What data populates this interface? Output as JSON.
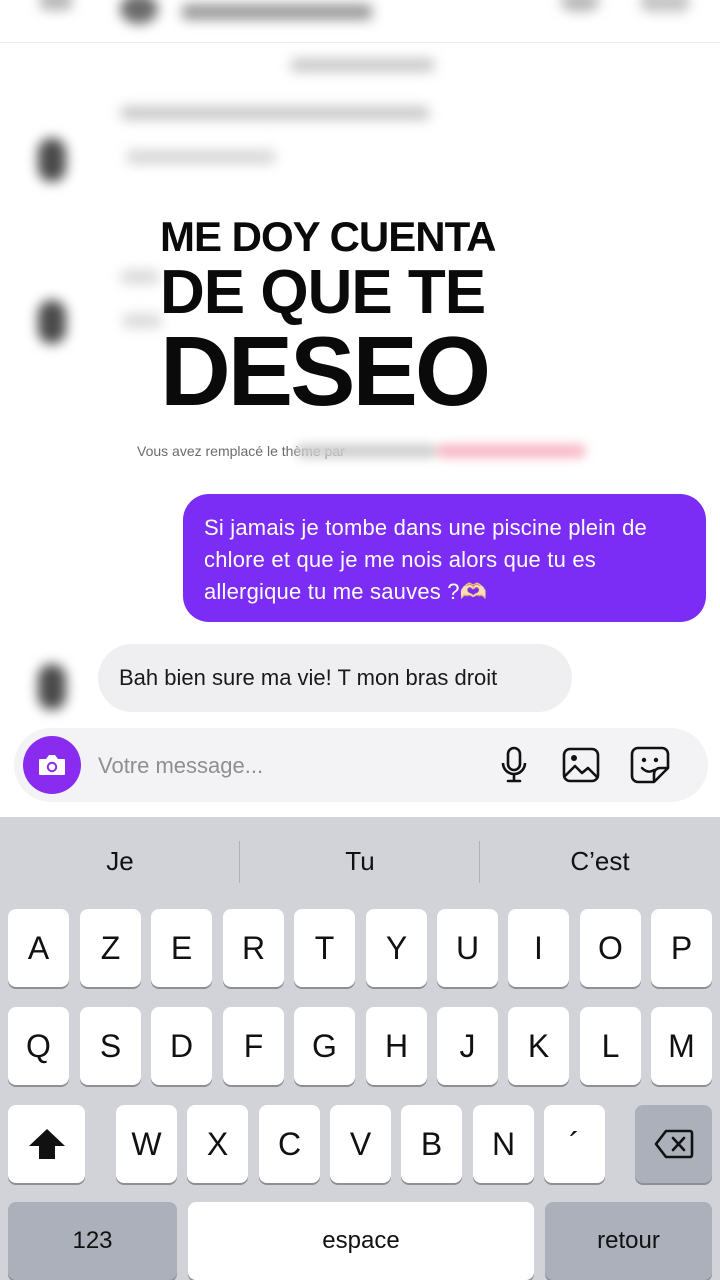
{
  "headline": {
    "line1": "ME DOY CUENTA",
    "line2": "DE QUE TE",
    "line3": "DESEO"
  },
  "system_note": "Vous avez remplacé le thème par",
  "messages": {
    "outgoing": "Si jamais je tombe dans une piscine plein de chlore et que je me nois alors que tu es allergique tu me sauves ?🫶🏻",
    "incoming": "Bah bien sure ma vie! T mon bras droit"
  },
  "composer": {
    "placeholder": "Votre message...",
    "accent_color": "#8a2cf0"
  },
  "keyboard": {
    "suggestions": [
      "Je",
      "Tu",
      "C’est"
    ],
    "row1": [
      "A",
      "Z",
      "E",
      "R",
      "T",
      "Y",
      "U",
      "I",
      "O",
      "P"
    ],
    "row2": [
      "Q",
      "S",
      "D",
      "F",
      "G",
      "H",
      "J",
      "K",
      "L",
      "M"
    ],
    "row3": [
      "W",
      "X",
      "C",
      "V",
      "B",
      "N",
      "´"
    ],
    "numbers_label": "123",
    "space_label": "espace",
    "return_label": "retour"
  },
  "colors": {
    "outgoing_bubble": "#7b2cf5",
    "incoming_bubble": "#efeff2",
    "keyboard_bg": "#d1d3d9"
  }
}
